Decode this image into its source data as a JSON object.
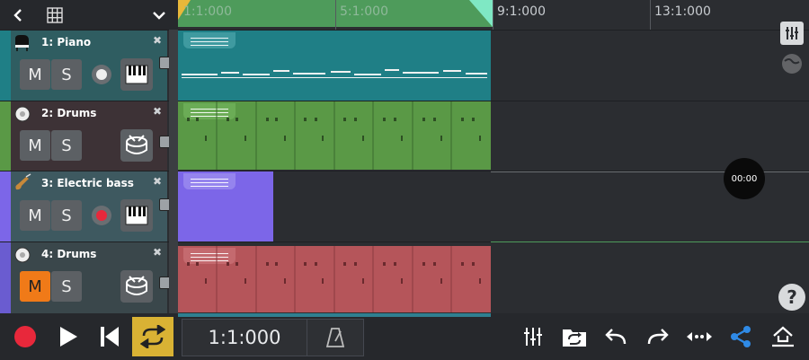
{
  "ruler": {
    "marks": [
      "1:1:000",
      "5:1:000",
      "9:1:000",
      "13:1:000"
    ]
  },
  "tracks": [
    {
      "title": "1: Piano",
      "mute_label": "M",
      "solo_label": "S",
      "instrument": "piano-keys-icon",
      "color": "#1f7f86",
      "record_armed": false
    },
    {
      "title": "2: Drums",
      "mute_label": "M",
      "solo_label": "S",
      "instrument": "drum-icon",
      "color": "#5a9946",
      "record_armed": false
    },
    {
      "title": "3: Electric bass",
      "mute_label": "M",
      "solo_label": "S",
      "instrument": "piano-keys-icon",
      "color": "#7c66e8",
      "record_armed": true
    },
    {
      "title": "4: Drums",
      "mute_label": "M",
      "solo_label": "S",
      "instrument": "drum-icon",
      "color": "#b5555a",
      "record_armed": false,
      "muted": true
    }
  ],
  "transport": {
    "position": "1:1:000"
  },
  "timer": {
    "label": "00:00"
  },
  "help": {
    "label": "?"
  },
  "colors": {
    "loop_region": "#4e9b5b",
    "mute_active": "#f07a18",
    "record": "#e8283b",
    "loop_button": "#d9b234",
    "share": "#2f8ae6"
  }
}
